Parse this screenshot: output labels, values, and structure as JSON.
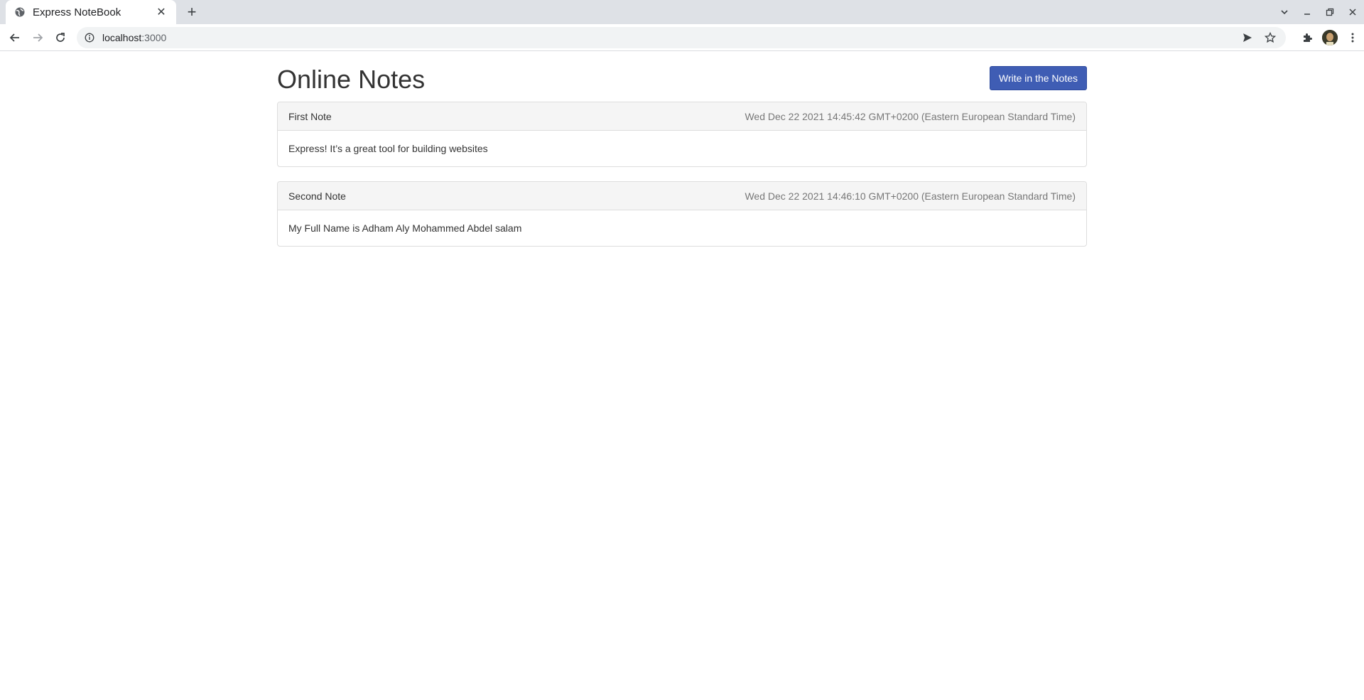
{
  "browser": {
    "tab_title": "Express NoteBook",
    "tab_close": "✕",
    "new_tab": "+",
    "url_host": "localhost",
    "url_port": ":3000"
  },
  "page": {
    "title": "Online Notes",
    "write_button": "Write in the Notes",
    "notes": [
      {
        "title": "First Note",
        "date": "Wed Dec 22 2021 14:45:42 GMT+0200 (Eastern European Standard Time)",
        "body": "Express! It’s a great tool for building websites"
      },
      {
        "title": "Second Note",
        "date": "Wed Dec 22 2021 14:46:10 GMT+0200 (Eastern European Standard Time)",
        "body": "My Full Name is Adham Aly Mohammed Abdel salam"
      }
    ]
  },
  "colors": {
    "accent": "#3f5db4",
    "panel_heading": "#f5f5f5",
    "border": "#dddddd"
  }
}
